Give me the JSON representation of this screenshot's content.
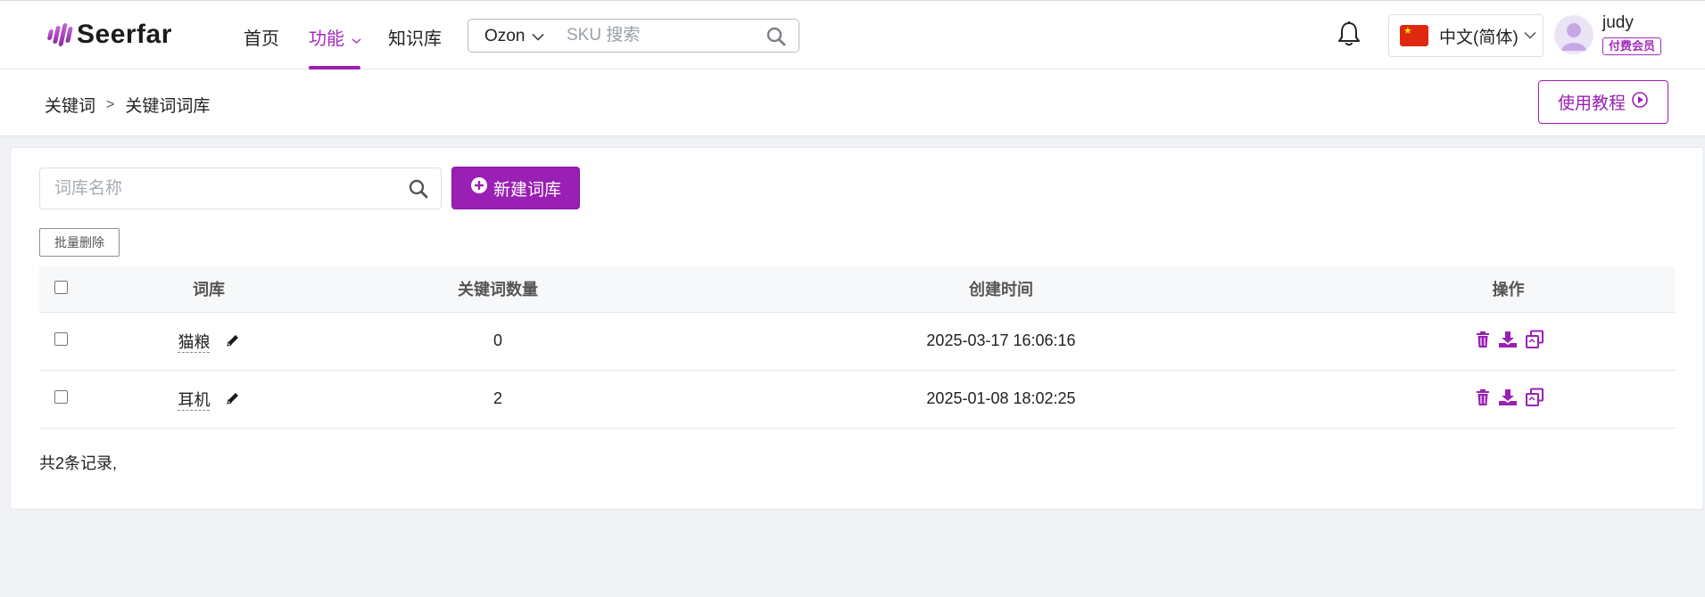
{
  "header": {
    "brand": "Seerfar",
    "nav": [
      {
        "label": "首页"
      },
      {
        "label": "功能"
      },
      {
        "label": "知识库"
      }
    ],
    "search": {
      "platform": "Ozon",
      "placeholder": "SKU 搜索"
    },
    "language": "中文(简体)",
    "user": {
      "name": "judy",
      "badge": "付费会员"
    },
    "accent_color": "#9a1fb4"
  },
  "breadcrumb": {
    "items": [
      "关键词",
      "关键词词库"
    ],
    "separator": ">",
    "tutorial_button": "使用教程"
  },
  "main": {
    "search_placeholder": "词库名称",
    "new_button": "新建词库",
    "batch_delete": "批量删除",
    "table": {
      "headers": [
        "词库",
        "关键词数量",
        "创建时间",
        "操作"
      ],
      "rows": [
        {
          "name": "猫粮",
          "count": "0",
          "created": "2025-03-17 16:06:16"
        },
        {
          "name": "耳机",
          "count": "2",
          "created": "2025-01-08 18:02:25"
        }
      ]
    },
    "total": "共2条记录,"
  }
}
